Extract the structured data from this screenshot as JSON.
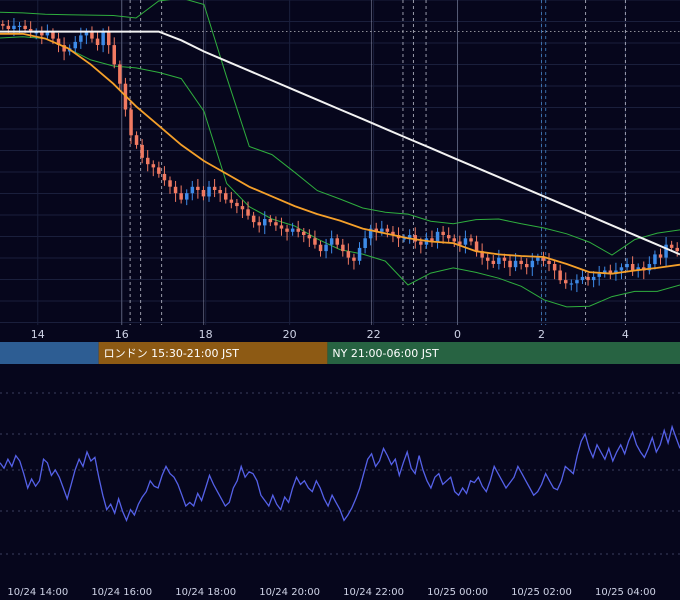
{
  "chart_data": [
    {
      "type": "candlestick",
      "panel": "price",
      "colors": {
        "up": "#3d8be8",
        "down": "#f07a62",
        "bollinger": "#2fae3e",
        "ma_short": "#f5a02a",
        "ma_long": "#f2f2f2",
        "ref_line": "#ffffff",
        "grid": "#1a1f3c"
      },
      "x_ticks": [
        {
          "pos": 0,
          "label": "14"
        },
        {
          "pos": 2,
          "label": "16"
        },
        {
          "pos": 4,
          "label": "18"
        },
        {
          "pos": 6,
          "label": "20"
        },
        {
          "pos": 8,
          "label": "22"
        },
        {
          "pos": 10,
          "label": "0"
        },
        {
          "pos": 12,
          "label": "2"
        },
        {
          "pos": 14,
          "label": "4"
        }
      ],
      "xlim": [
        -0.9,
        15.3
      ],
      "ylim": [
        0,
        100
      ],
      "vertical_lines_solid": [
        2.0,
        3.95,
        7.95,
        10.0
      ],
      "vertical_lines_dashed": [
        2.2,
        2.45,
        2.95,
        8.7,
        8.95,
        9.25,
        12.0,
        12.1,
        13.05,
        14.0
      ],
      "reference_level": 90.2,
      "candles_y": [
        92,
        91,
        92,
        92,
        91,
        90,
        90,
        89,
        90,
        88,
        86,
        84,
        85,
        87,
        89,
        90,
        88,
        86,
        90,
        86,
        80,
        74,
        66,
        58,
        55,
        51,
        49,
        48,
        46,
        44,
        42,
        40,
        38,
        40,
        42,
        41,
        39,
        42,
        41,
        40,
        38,
        37,
        36,
        35,
        33,
        31,
        30,
        32,
        31,
        30,
        29,
        28,
        29,
        28,
        27,
        26,
        24,
        22,
        24,
        26,
        24,
        22,
        20,
        19,
        23,
        26,
        29,
        28,
        29,
        28,
        27,
        26,
        26,
        27,
        25,
        24,
        26,
        25,
        28,
        27,
        26,
        25,
        24,
        26,
        25,
        22,
        20,
        19,
        18,
        20,
        19,
        17,
        19,
        18,
        17,
        19,
        20,
        19,
        18,
        16,
        13,
        12,
        12,
        13,
        14,
        13,
        14,
        15,
        16,
        15,
        16,
        17,
        18,
        16,
        17,
        16,
        18,
        21,
        20,
        24,
        23,
        22
      ],
      "ma_short_y": [
        89.5,
        89.5,
        88,
        85,
        80,
        74,
        67,
        61,
        55,
        50,
        46,
        42,
        39,
        36,
        33.5,
        31.5,
        29,
        27.5,
        26,
        25,
        24.5,
        22,
        21,
        20.5,
        20.2,
        18,
        15.5,
        15,
        16,
        16.8,
        17.8
      ],
      "ma_long_y": [
        90.2,
        90.2,
        90.2,
        90.2,
        90.2,
        90.2,
        90.2,
        90.2,
        87.5,
        84,
        81,
        78,
        75,
        72,
        69,
        66,
        63,
        60,
        57,
        54,
        51,
        48,
        45,
        42,
        39,
        36,
        33,
        30,
        27,
        24,
        21
      ],
      "bb_upper_y": [
        96.2,
        96,
        95.6,
        95.4,
        95.3,
        95.2,
        94.4,
        99.7,
        100.6,
        98.6,
        76,
        54.5,
        52,
        46.5,
        40.8,
        38.2,
        35.4,
        34.1,
        33.5,
        31.3,
        30.5,
        31.8,
        32,
        30.5,
        29.2,
        27.4,
        24.8,
        20.8,
        25.6,
        27.6,
        28.6
      ],
      "bb_lower_y": [
        88.2,
        88.6,
        88,
        84.9,
        81.4,
        79.5,
        78.9,
        77.5,
        75.6,
        65.4,
        43,
        35.8,
        32,
        29.8,
        25.8,
        22.5,
        21.1,
        18.9,
        11.5,
        15.2,
        16.8,
        15.4,
        13.6,
        11.1,
        6.9,
        4.7,
        4.9,
        7.9,
        9.5,
        9.5,
        11.5
      ]
    },
    {
      "type": "line",
      "panel": "oscillator",
      "color": "#5561e8",
      "xlim": [
        -0.9,
        15.3
      ],
      "ylim": [
        0,
        100
      ],
      "values": [
        54,
        51,
        56,
        52,
        58,
        55,
        48,
        40,
        45,
        41,
        44,
        56,
        54,
        47,
        50,
        46,
        40,
        34,
        42,
        50,
        56,
        52,
        60,
        55,
        57,
        46,
        36,
        28,
        31,
        26,
        34,
        27,
        22,
        28,
        25,
        31,
        35,
        38,
        44,
        41,
        40,
        47,
        52,
        48,
        46,
        42,
        36,
        30,
        32,
        30,
        37,
        33,
        40,
        47,
        42,
        38,
        34,
        30,
        32,
        40,
        44,
        52,
        46,
        49,
        48,
        44,
        36,
        33,
        30,
        36,
        31,
        28,
        35,
        32,
        40,
        46,
        42,
        44,
        40,
        38,
        44,
        40,
        34,
        30,
        36,
        32,
        28,
        22,
        25,
        29,
        34,
        40,
        48,
        56,
        59,
        52,
        55,
        62,
        58,
        53,
        56,
        47,
        54,
        60,
        51,
        48,
        58,
        50,
        44,
        40,
        46,
        48,
        42,
        44,
        46,
        38,
        36,
        40,
        37,
        44,
        43,
        46,
        41,
        38,
        44,
        52,
        48,
        44,
        40,
        43,
        46,
        52,
        48,
        44,
        40,
        36,
        38,
        42,
        48,
        44,
        40,
        39,
        44,
        52,
        50,
        48,
        58,
        66,
        70,
        62,
        57,
        64,
        60,
        56,
        62,
        55,
        60,
        64,
        59,
        66,
        71,
        64,
        60,
        57,
        62,
        68,
        60,
        64,
        72,
        65,
        74,
        68,
        62
      ],
      "x_ticks": [
        {
          "pos": 0,
          "label": "10/24 14:00"
        },
        {
          "pos": 2,
          "label": "10/24 16:00"
        },
        {
          "pos": 4,
          "label": "10/24 18:00"
        },
        {
          "pos": 6,
          "label": "10/24 20:00"
        },
        {
          "pos": 8,
          "label": "10/24 22:00"
        },
        {
          "pos": 10,
          "label": "10/25 00:00"
        },
        {
          "pos": 12,
          "label": "10/25 02:00"
        },
        {
          "pos": 14,
          "label": "10/25 04:00"
        }
      ]
    }
  ],
  "sessions": [
    {
      "label": "",
      "start": -0.9,
      "end": 1.45,
      "color": "#2d5d93"
    },
    {
      "label": "ロンドン 15:30-21:00 JST",
      "start": 1.45,
      "end": 6.9,
      "color": "#8d5a14"
    },
    {
      "label": "NY 21:00-06:00 JST",
      "start": 6.9,
      "end": 15.3,
      "color": "#276342"
    }
  ]
}
